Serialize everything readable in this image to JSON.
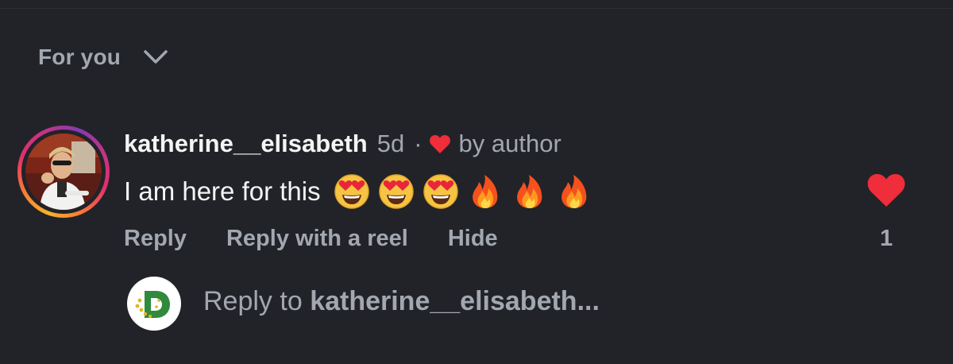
{
  "sort": {
    "label": "For you",
    "icon": "chevron-down-icon"
  },
  "comment": {
    "username": "katherine__elisabeth",
    "time": "5d",
    "separator": "·",
    "author_like_text": "by author",
    "text": "I am here for this",
    "emojis": [
      "heart-eyes",
      "heart-eyes",
      "heart-eyes",
      "fire",
      "fire",
      "fire"
    ],
    "actions": {
      "reply": "Reply",
      "reply_reel": "Reply with a reel",
      "hide": "Hide"
    },
    "like_count": "1",
    "liked": true
  },
  "reply_box": {
    "prefix": "Reply to ",
    "username": "katherine__elisabeth..."
  },
  "colors": {
    "background": "#222328",
    "secondary_text": "#a2a7b0",
    "like_red": "#ef2d3b"
  }
}
